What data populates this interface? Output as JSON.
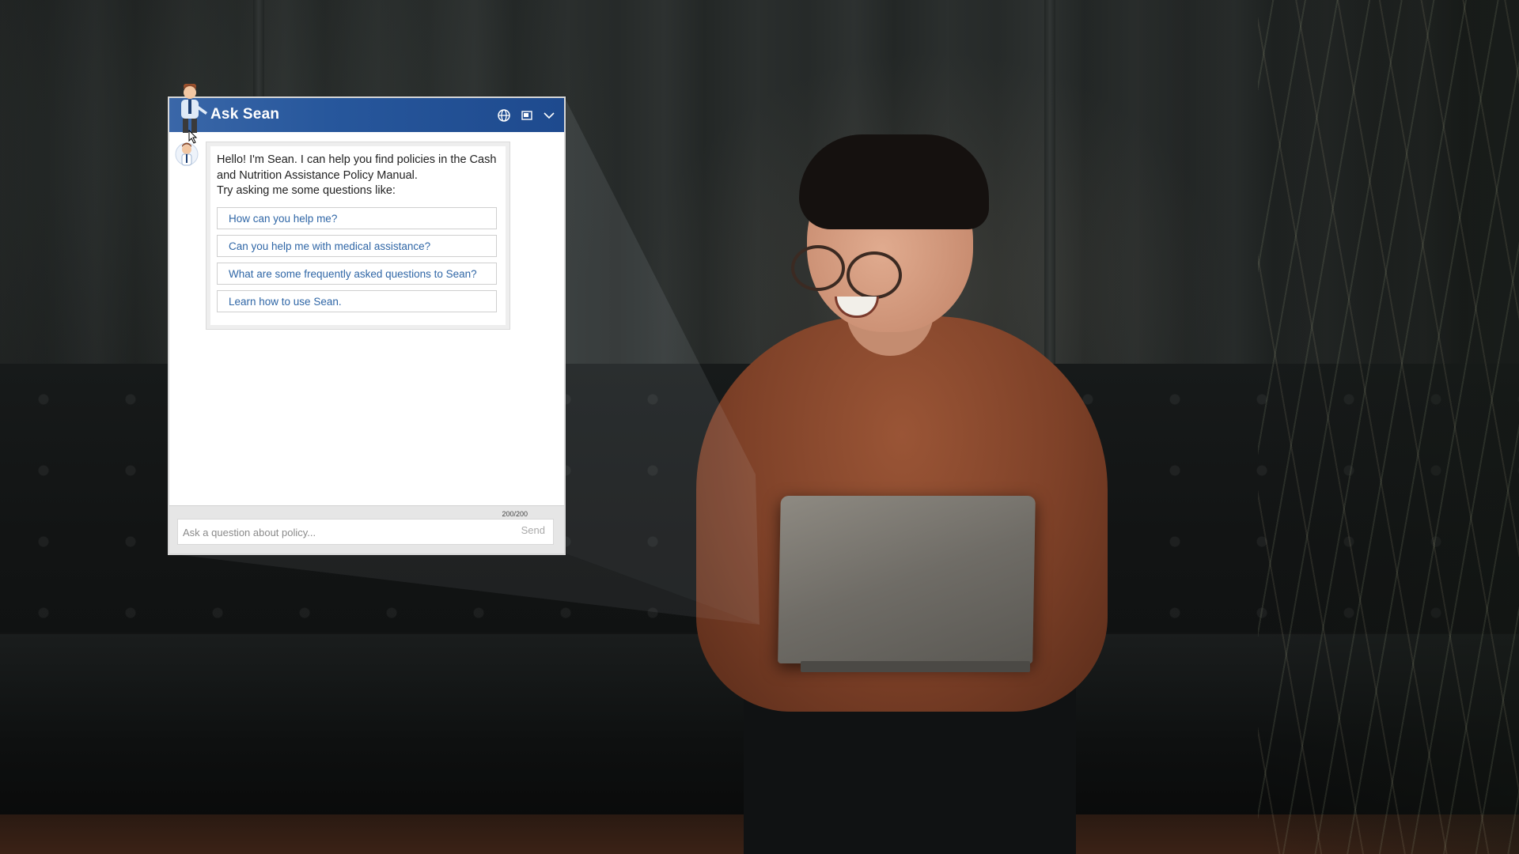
{
  "chat": {
    "title": "Ask Sean",
    "greeting_lines": [
      "Hello! I'm Sean. I can help you find policies in the Cash",
      "and Nutrition Assistance Policy Manual.",
      "Try asking me some questions like:"
    ],
    "suggestions": [
      "How can you help me?",
      "Can you help me with medical assistance?",
      "What are some frequently asked questions to Sean?",
      "Learn how to use Sean."
    ],
    "char_count": "200/200",
    "input_placeholder": "Ask a question about policy...",
    "send_label": "Send",
    "header_icons": [
      "globe-icon",
      "window-icon",
      "chevron-down-icon"
    ]
  },
  "colors": {
    "header_start": "#3a67a8",
    "header_end": "#1e4a8e",
    "link": "#2f66a6"
  }
}
